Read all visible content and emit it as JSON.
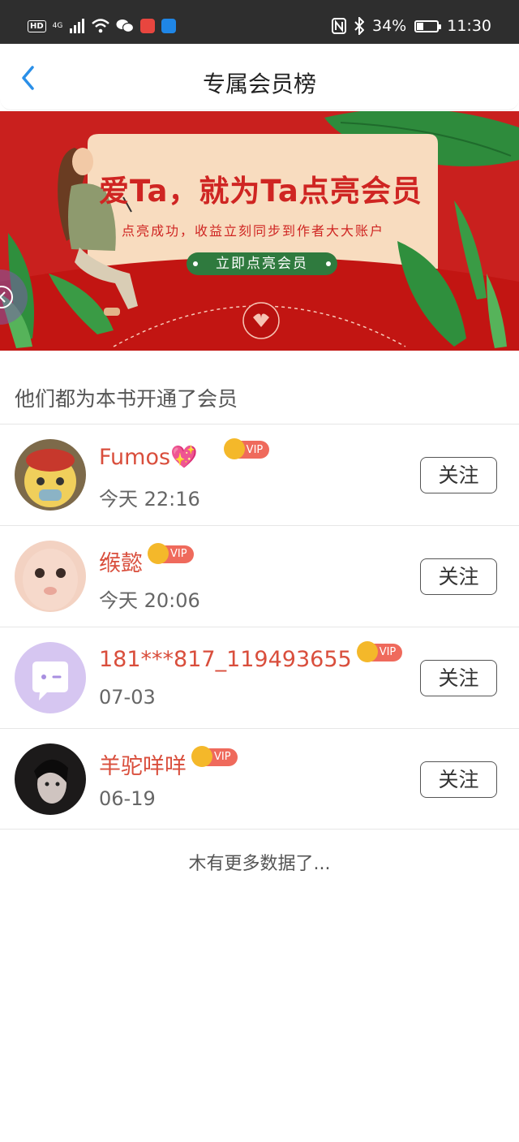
{
  "status_bar": {
    "hd": "HD",
    "network": "4G",
    "battery_percent": "34%",
    "battery_level": 0.34,
    "time": "11:30",
    "icons": [
      "signal-icon",
      "wifi-icon",
      "wechat-icon",
      "app-icon",
      "app-icon",
      "nfc-icon",
      "bluetooth-icon",
      "battery-icon"
    ]
  },
  "header": {
    "title": "专属会员榜",
    "back_icon": "chevron-left-icon"
  },
  "banner": {
    "headline": "爱Ta，就为Ta点亮会员",
    "subline": "点亮成功，收益立刻同步到作者大大账户",
    "button": "立即点亮会员"
  },
  "section_title": "他们都为本书开通了会员",
  "members": [
    {
      "name": "Fumos💖",
      "time": "今天 22:16",
      "vip": "VIP",
      "follow": "关注"
    },
    {
      "name": "缑懿",
      "time": "今天 20:06",
      "vip": "VIP",
      "follow": "关注"
    },
    {
      "name": "181***817_119493655",
      "time": "07-03",
      "vip": "VIP",
      "follow": "关注"
    },
    {
      "name": "羊驼咩咩",
      "time": "06-19",
      "vip": "VIP",
      "follow": "关注"
    }
  ],
  "footer_text": "木有更多数据了...",
  "colors": {
    "accent_blue": "#2a8fe8",
    "name_red": "#d94e3c",
    "vip_red": "#ef6a5c",
    "banner_red": "#c9201e"
  }
}
